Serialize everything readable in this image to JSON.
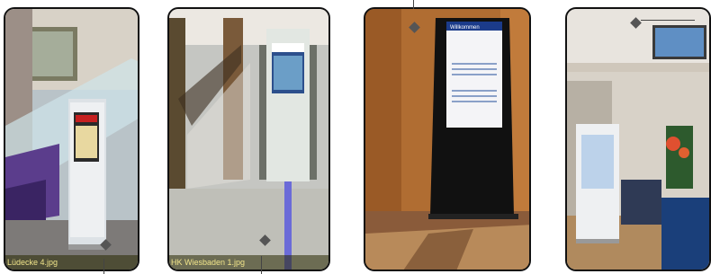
{
  "gallery": {
    "photos": [
      {
        "caption": "Lüdecke 4.jpg",
        "subject": "kiosk-stairwell"
      },
      {
        "caption": "HK Wiesbaden 1.jpg",
        "subject": "kiosk-atrium"
      },
      {
        "caption": "",
        "subject": "kiosk-welcome-screen"
      },
      {
        "caption": "",
        "subject": "kiosk-lobby"
      }
    ],
    "screen_text": {
      "welcome": "Willkommen"
    }
  }
}
